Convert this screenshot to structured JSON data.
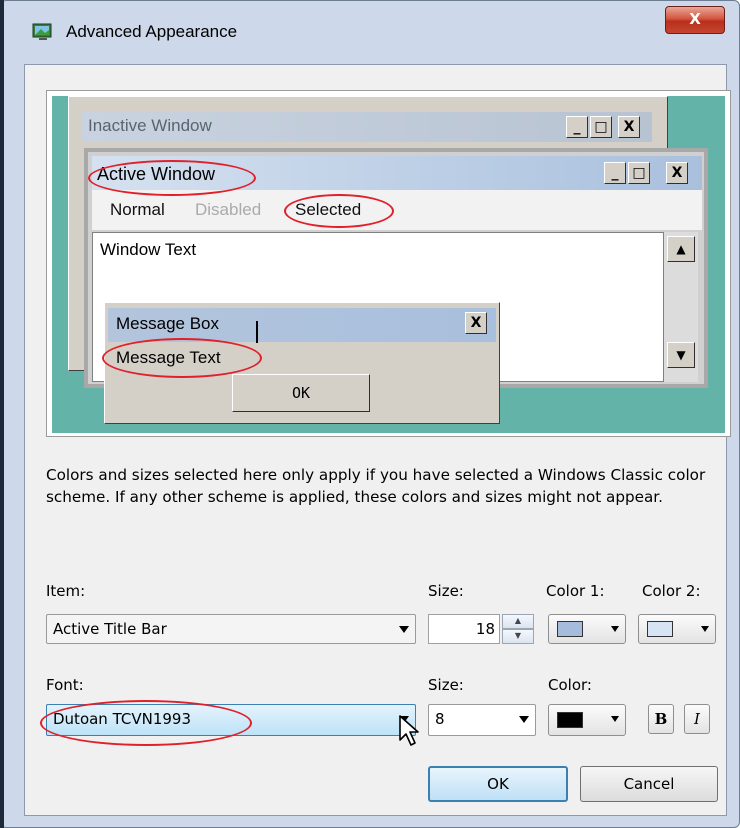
{
  "window": {
    "title": "Advanced Appearance",
    "close_glyph": "X"
  },
  "preview": {
    "inactive_title": "Inactive Window",
    "active_title": "Active Window",
    "caption_buttons": {
      "minimize": "_",
      "maximize": "□",
      "close": "X"
    },
    "menu": {
      "normal": "Normal",
      "disabled": "Disabled",
      "selected": "Selected"
    },
    "window_text": "Window Text",
    "scroll_up": "▲",
    "scroll_down": "▼",
    "message_box_title": "Message Box",
    "message_text": "Message Text",
    "message_ok": "OK",
    "message_close": "X",
    "desktop_color": "#63b3a8",
    "annotation_color": "#e0202a"
  },
  "description": "Colors and sizes selected here only apply if you have selected a Windows Classic color scheme. If any other scheme is applied, these colors and sizes might not appear.",
  "item": {
    "label": "Item:",
    "value": "Active Title Bar",
    "size_label": "Size:",
    "size_value": "18",
    "color1_label": "Color 1:",
    "color2_label": "Color 2:",
    "color1": "#a6bcdc",
    "color2": "#d6e4f4"
  },
  "font": {
    "label": "Font:",
    "value": "Dutoan TCVN1993",
    "size_label": "Size:",
    "size_value": "8",
    "color_label": "Color:",
    "color": "#000000",
    "bold_label": "B",
    "italic_label": "I"
  },
  "buttons": {
    "ok": "OK",
    "cancel": "Cancel"
  }
}
